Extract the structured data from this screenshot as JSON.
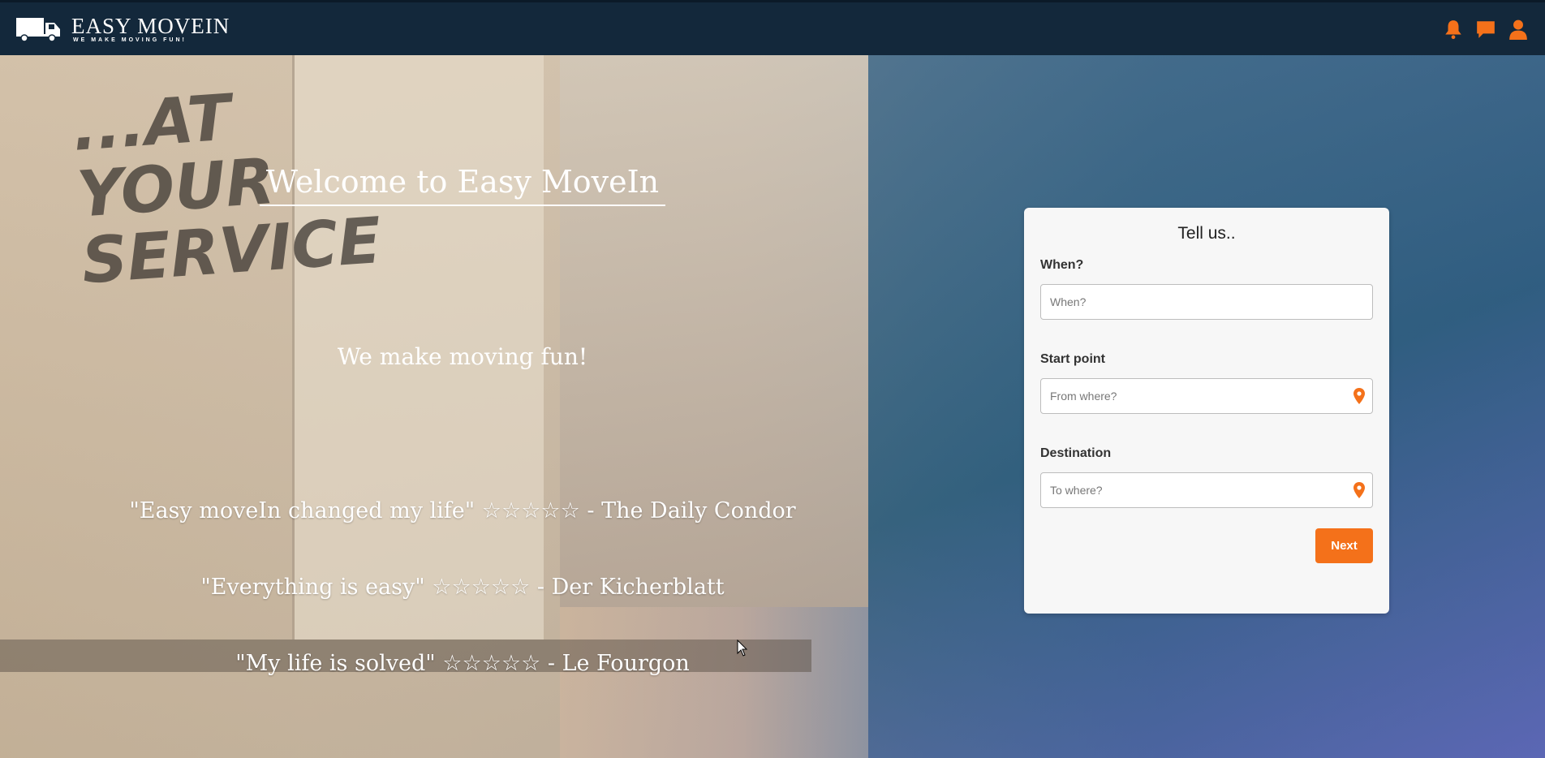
{
  "header": {
    "brand_name": "EASY MOVEIN",
    "brand_tagline": "WE MAKE MOVING FUN!",
    "icons": [
      "truck-icon",
      "bell-icon",
      "chat-icon",
      "user-icon"
    ]
  },
  "hero": {
    "welcome_title": "Welcome to Easy MoveIn",
    "subtitle": "We make moving fun!",
    "truck_text": "...AT YOUR SERVICE",
    "quotes": [
      "\"Easy moveIn changed my life\" ☆☆☆☆☆ - The Daily Condor",
      "\"Everything is easy\" ☆☆☆☆☆ - Der Kicherblatt",
      "\"My life is solved\" ☆☆☆☆☆ - Le Fourgon"
    ]
  },
  "form": {
    "title": "Tell us..",
    "fields": [
      {
        "label": "When?",
        "placeholder": "When?",
        "value": ""
      },
      {
        "label": "Start point",
        "placeholder": "From where?",
        "value": "",
        "icon": "map-pin-icon"
      },
      {
        "label": "Destination",
        "placeholder": "To where?",
        "value": "",
        "icon": "map-pin-icon"
      }
    ],
    "next_label": "Next"
  },
  "colors": {
    "navbar": "#13283b",
    "accent": "#f4711a",
    "card": "#f7f7f7"
  }
}
